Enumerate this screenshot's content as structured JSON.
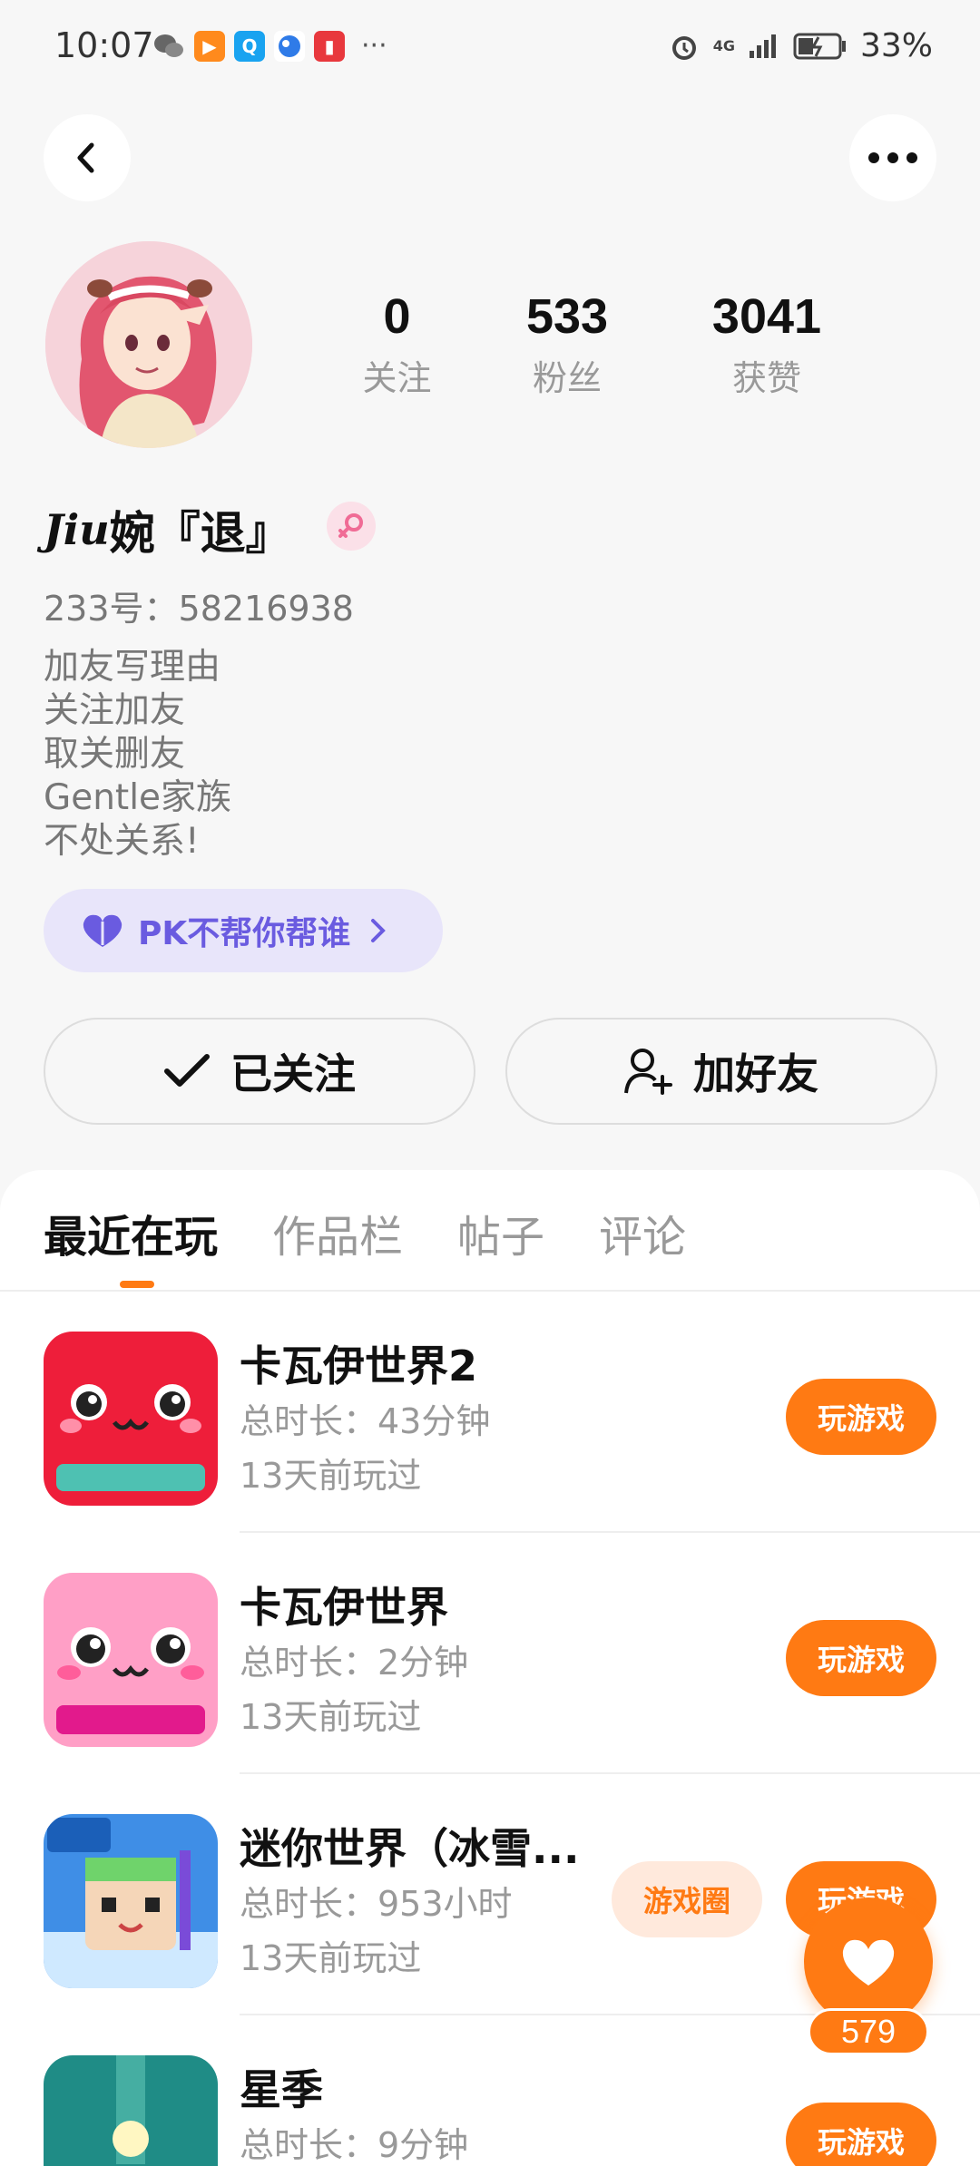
{
  "status_bar": {
    "time": "10:07",
    "battery": "33%",
    "network": "4G"
  },
  "profile": {
    "nickname_script": "Jiu",
    "nickname": "婉『退』",
    "uid": "233号：58216938",
    "stats": [
      {
        "value": "0",
        "label": "关注"
      },
      {
        "value": "533",
        "label": "粉丝"
      },
      {
        "value": "3041",
        "label": "获赞"
      }
    ],
    "bio": [
      "加友写理由",
      "关注加友",
      "取关删友",
      "Gentle家族",
      "不处关系!"
    ],
    "pk_label": "PK不帮你帮谁"
  },
  "actions": {
    "follow_label": "已关注",
    "friend_label": "加好友"
  },
  "tabs": [
    "最近在玩",
    "作品栏",
    "帖子",
    "评论"
  ],
  "games": [
    {
      "name": "卡瓦伊世界2",
      "duration": "总时长：43分钟",
      "last_played": "13天前玩过",
      "play_label": "玩游戏"
    },
    {
      "name": "卡瓦伊世界",
      "duration": "总时长：2分钟",
      "last_played": "13天前玩过",
      "play_label": "玩游戏"
    },
    {
      "name": "迷你世界（冰雪...",
      "duration": "总时长：953小时",
      "last_played": "13天前玩过",
      "circle_label": "游戏圈",
      "play_label": "玩游戏"
    },
    {
      "name": "星季",
      "duration": "总时长：9分钟",
      "last_played": "",
      "play_label": "玩游戏"
    }
  ],
  "fab": {
    "like_count": "579"
  },
  "colors": {
    "accent": "#ff7a13",
    "pk": "#6a5be0"
  }
}
